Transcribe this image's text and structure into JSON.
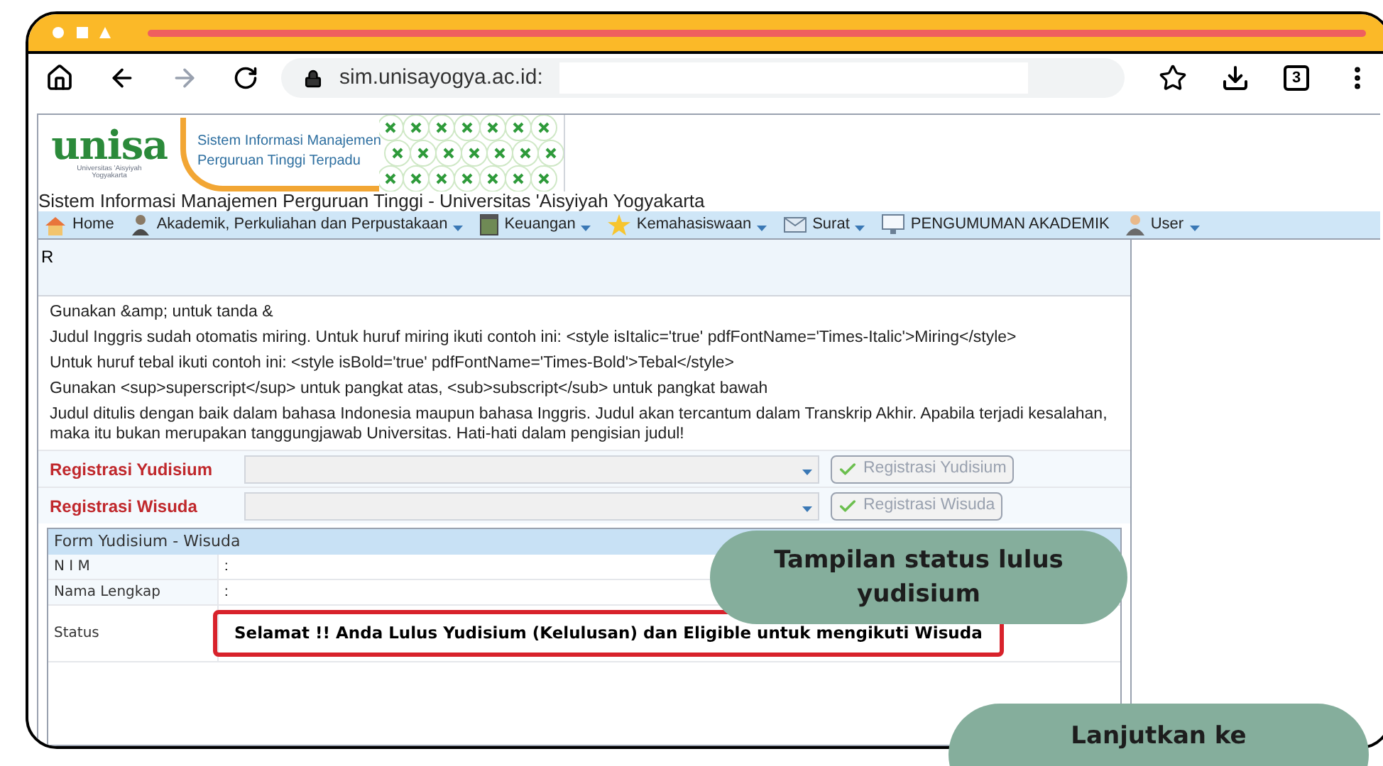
{
  "browser": {
    "url": "sim.unisayogya.ac.id:",
    "tab_count": "3"
  },
  "header": {
    "logo": "unisa",
    "logo_subtitle": [
      "Universitas 'Aisyiyah",
      "Yogyakarta"
    ],
    "system_name": [
      "Sistem Informasi Manajemen",
      "Perguruan Tinggi Terpadu"
    ],
    "site_title": "Sistem Informasi Manajemen Perguruan Tinggi - Universitas 'Aisyiyah Yogyakarta"
  },
  "menu": [
    {
      "label": "Home",
      "kind": "home",
      "dropdown": false
    },
    {
      "label": "Akademik, Perkuliahan dan Perpustakaan",
      "kind": "person",
      "dropdown": true
    },
    {
      "label": "Keuangan",
      "kind": "box",
      "dropdown": true
    },
    {
      "label": "Kemahasiswaan",
      "kind": "star",
      "dropdown": true
    },
    {
      "label": "Surat",
      "kind": "mail",
      "dropdown": true
    },
    {
      "label": "PENGUMUMAN AKADEMIK",
      "kind": "monitor",
      "dropdown": false
    },
    {
      "label": "User",
      "kind": "user",
      "dropdown": true
    }
  ],
  "panel": {
    "heading": "R",
    "notes": [
      "Gunakan &amp; untuk tanda &",
      "Judul Inggris sudah otomatis miring. Untuk huruf miring ikuti contoh ini: <style isItalic='true' pdfFontName='Times-Italic'>Miring</style>",
      "Untuk huruf tebal ikuti contoh ini: <style isBold='true' pdfFontName='Times-Bold'>Tebal</style>",
      "Gunakan <sup>superscript</sup> untuk pangkat atas, <sub>subscript</sub> untuk pangkat bawah",
      "Judul ditulis dengan baik dalam bahasa Indonesia maupun bahasa Inggris. Judul akan tercantum dalam Transkrip Akhir. Apabila terjadi kesalahan, maka itu bukan merupakan tanggungjawab Universitas. Hati-hati dalam pengisian judul!"
    ]
  },
  "registrations": [
    {
      "label": "Registrasi Yudisium",
      "button": "Registrasi Yudisium",
      "disabled": true
    },
    {
      "label": "Registrasi Wisuda",
      "button": "Registrasi Wisuda",
      "disabled": true
    }
  ],
  "form": {
    "title": "Form Yudisium - Wisuda",
    "fields": [
      {
        "label": "N I M",
        "value": ":",
        "highlighted": false
      },
      {
        "label": "Nama Lengkap",
        "value": ":",
        "highlighted": false
      },
      {
        "label": "Status",
        "value": "Selamat !! Anda Lulus Yudisium  (Kelulusan) dan Eligible untuk mengikuti Wisuda",
        "highlighted": true
      }
    ]
  },
  "callouts": [
    {
      "text": "Tampilan status lulus yudisium"
    },
    {
      "text": "Lanjutkan ke"
    }
  ]
}
